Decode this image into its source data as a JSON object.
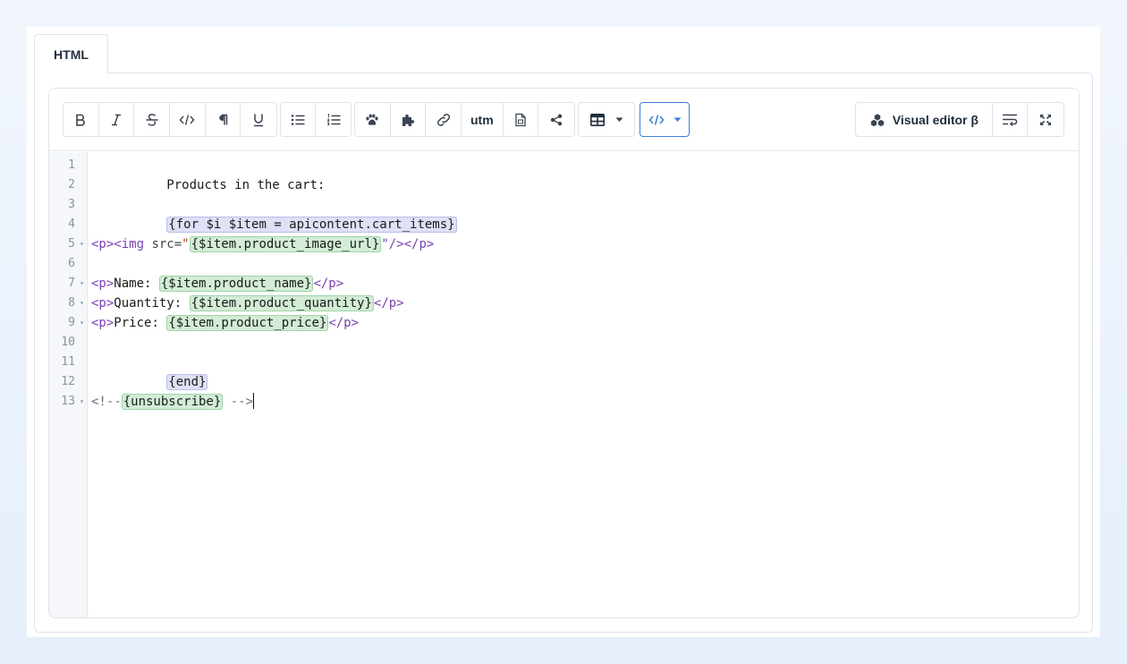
{
  "tab": {
    "label": "HTML"
  },
  "toolbar": {
    "format_buttons": [
      {
        "icon": "bold-icon",
        "label": "B"
      },
      {
        "icon": "italic-icon",
        "label": "I"
      },
      {
        "icon": "strikethrough-icon",
        "label": "S"
      },
      {
        "icon": "inline-code-icon",
        "label": "</>"
      },
      {
        "icon": "paragraph-icon",
        "label": "¶"
      },
      {
        "icon": "underline-icon",
        "label": "U"
      }
    ],
    "list_buttons": [
      {
        "icon": "bulleted-list-icon"
      },
      {
        "icon": "numbered-list-icon"
      }
    ],
    "insert_buttons": [
      {
        "icon": "paw-icon"
      },
      {
        "icon": "puzzle-icon"
      },
      {
        "icon": "link-icon"
      },
      {
        "icon": "utm-button",
        "label": "utm"
      },
      {
        "icon": "file-icon"
      },
      {
        "icon": "share-icon"
      }
    ],
    "table_button": {
      "icon": "table-icon",
      "dropdown": "chevron-down-icon"
    },
    "code_view_button": {
      "icon": "code-icon",
      "dropdown": "chevron-down-icon",
      "active": true
    },
    "visual_editor_label": "Visual editor β",
    "right_buttons": [
      {
        "icon": "visual-editor-icon"
      },
      {
        "icon": "wrap-lines-icon"
      },
      {
        "icon": "fullscreen-icon"
      }
    ]
  },
  "colors": {
    "accent": "#3b7ddd",
    "tag": "#7a3fb0",
    "token_green_bg": "#d2ecd6",
    "token_purple_bg": "#dfe1f6"
  },
  "code": {
    "lines": [
      {
        "n": "1",
        "fold": false
      },
      {
        "n": "2",
        "fold": false
      },
      {
        "n": "3",
        "fold": false
      },
      {
        "n": "4",
        "fold": false
      },
      {
        "n": "5",
        "fold": true
      },
      {
        "n": "6",
        "fold": false
      },
      {
        "n": "7",
        "fold": true
      },
      {
        "n": "8",
        "fold": true
      },
      {
        "n": "9",
        "fold": true
      },
      {
        "n": "10",
        "fold": false
      },
      {
        "n": "11",
        "fold": false
      },
      {
        "n": "12",
        "fold": false
      },
      {
        "n": "13",
        "fold": true
      }
    ],
    "l1_text": "Products in the cart:",
    "l3_token": "{for $i $item = apicontent.cart_items}",
    "l5_open": "<p><img ",
    "l5_attr": "src=",
    "l5_quote_open": "\"",
    "l5_token": "{$item.product_image_url}",
    "l5_close": "\"/></p>",
    "l7_open": "<p>",
    "l7_text": "Name: ",
    "l7_token": "{$item.product_name}",
    "l7_close": "</p>",
    "l8_open": "<p>",
    "l8_text": "Quantity: ",
    "l8_token": "{$item.product_quantity}",
    "l8_close": "</p>",
    "l9_open": "<p>",
    "l9_text": "Price: ",
    "l9_token": "{$item.product_price}",
    "l9_close": "</p>",
    "l11_token": "{end}",
    "l13_open": "<!--",
    "l13_token": "{unsubscribe}",
    "l13_close": " -->"
  }
}
